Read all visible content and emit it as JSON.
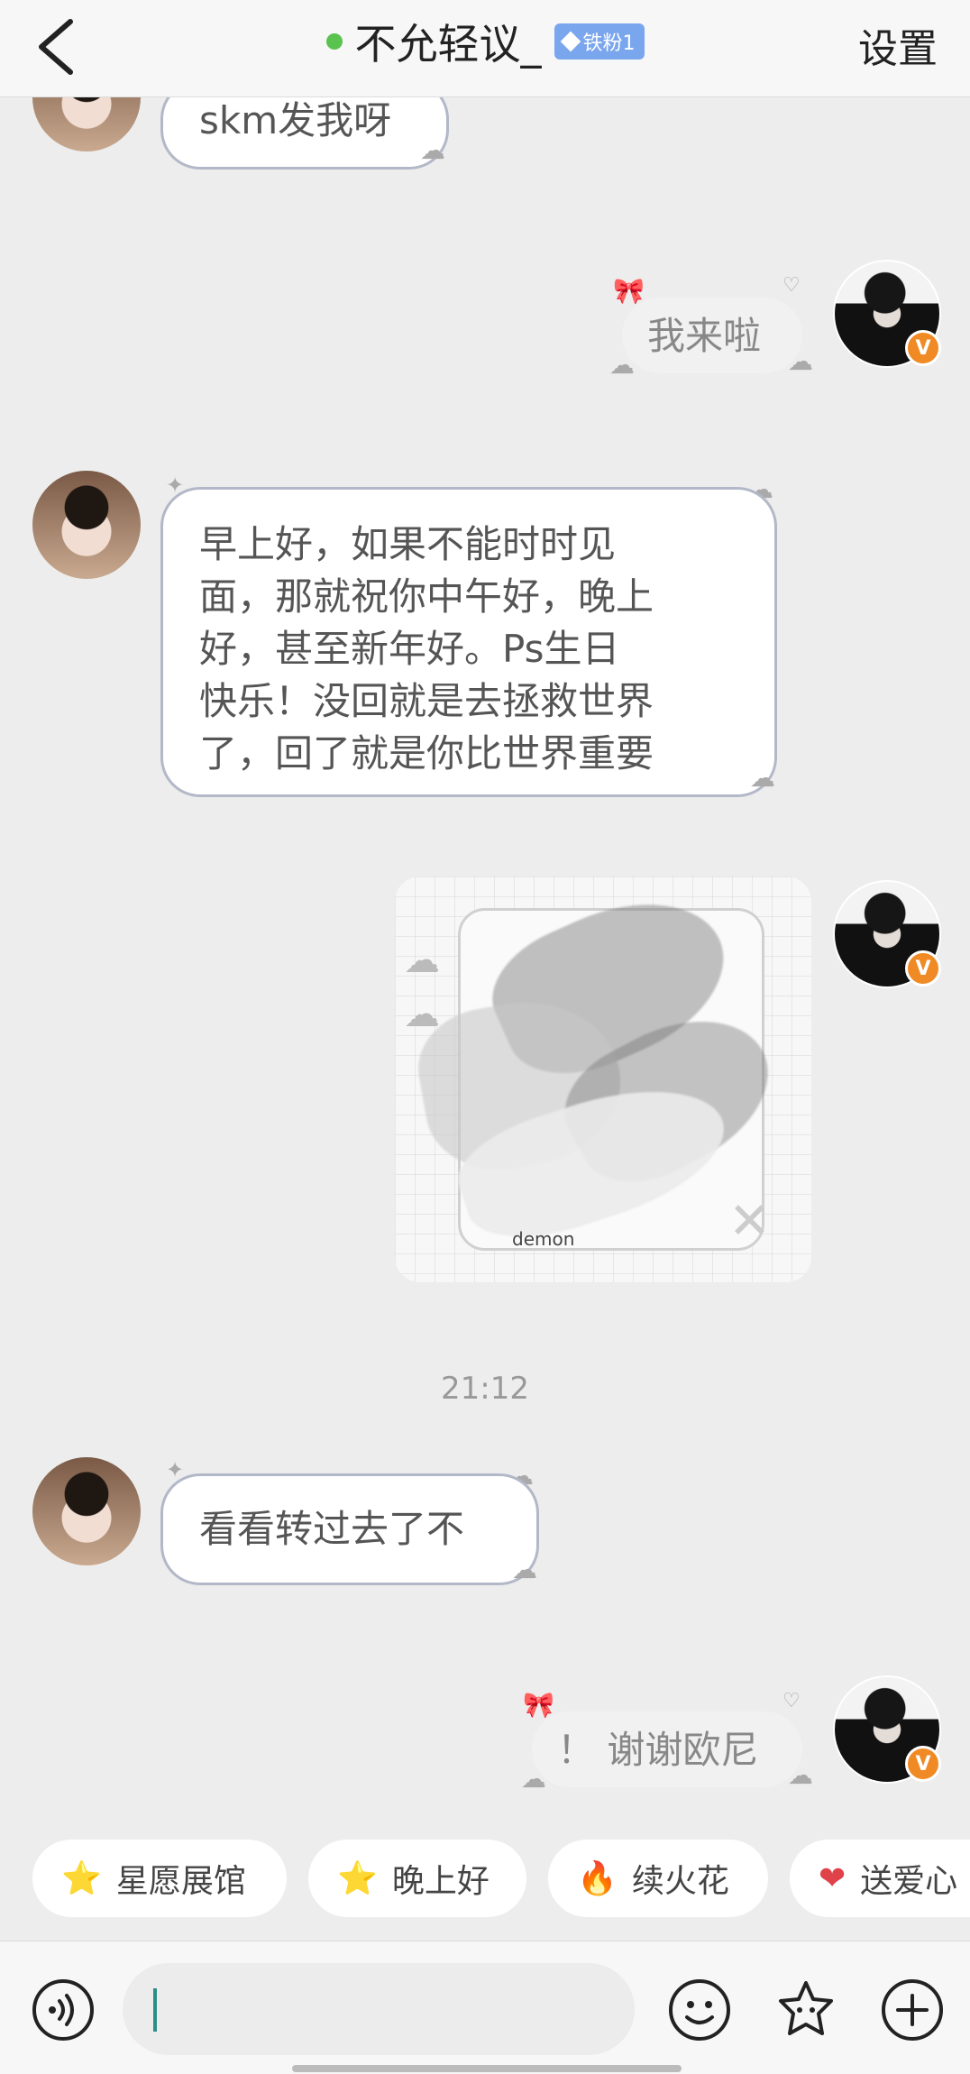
{
  "header": {
    "back_icon": "chevron-left-icon",
    "title": "不允轻议_",
    "badge": "铁粉1",
    "settings_label": "设置",
    "status_color": "#5ac24f"
  },
  "messages": {
    "m1": "skm发我呀",
    "m2": "我来啦",
    "m3_lines": [
      "早上好，如果不能时时见",
      "面，那就祝你中午好，晚上",
      "好，甚至新年好。Ps生日",
      "快乐！没回就是去拯救世界",
      "了，回了就是你比世界重要"
    ],
    "sticker_label": "demon",
    "timestamp": "21:12",
    "m4": "看看转过去了不",
    "m5": "！ 谢谢欧尼"
  },
  "quick_replies": [
    {
      "icon": "star-face-icon",
      "label": "星愿展馆"
    },
    {
      "icon": "star-face-icon",
      "label": "晚上好"
    },
    {
      "icon": "fire-icon",
      "label": "续火花"
    },
    {
      "icon": "heart-icon",
      "label": "送爱心"
    }
  ],
  "input_bar": {
    "voice_icon": "voice-icon",
    "input_value": "",
    "emoji_icon": "emoji-icon",
    "sticker_icon": "sticker-icon",
    "plus_icon": "plus-icon"
  },
  "verified_mark": "V"
}
